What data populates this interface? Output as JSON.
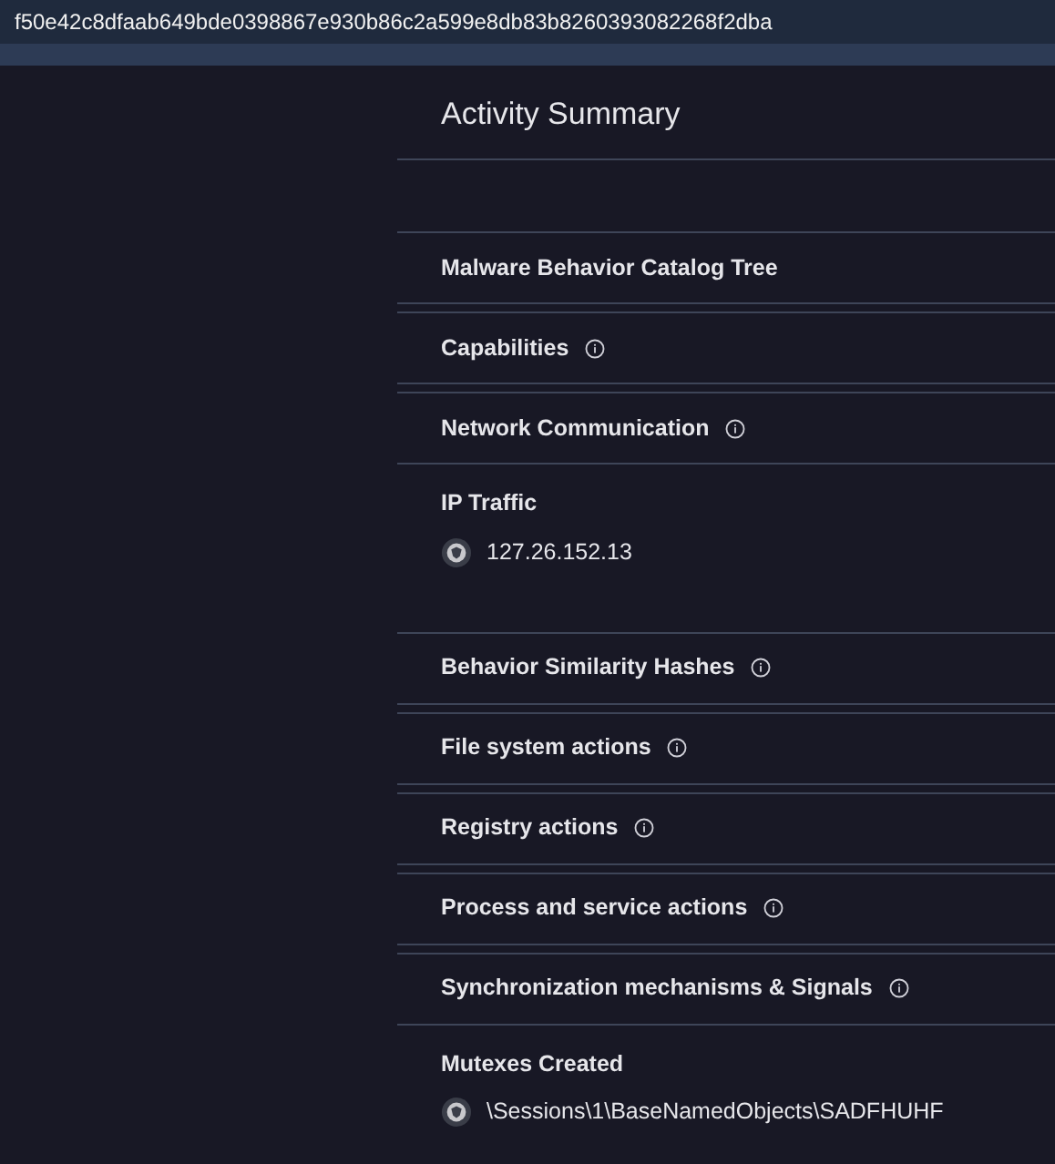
{
  "hash": "f50e42c8dfaab649bde0398867e930b86c2a599e8db83b8260393082268f2dba",
  "title": "Activity Summary",
  "sections": [
    {
      "title": "Malware Behavior Catalog Tree",
      "info": false
    },
    {
      "title": "Capabilities",
      "info": true
    },
    {
      "title": "Network Communication",
      "info": true,
      "detail": {
        "label": "IP Traffic",
        "entries": [
          "127.26.152.13"
        ]
      }
    },
    {
      "title": "Behavior Similarity Hashes",
      "info": true
    },
    {
      "title": "File system actions",
      "info": true
    },
    {
      "title": "Registry actions",
      "info": true
    },
    {
      "title": "Process and service actions",
      "info": true
    },
    {
      "title": "Synchronization mechanisms & Signals",
      "info": true,
      "detail": {
        "label": "Mutexes Created",
        "entries": [
          "\\Sessions\\1\\BaseNamedObjects\\SADFHUHF"
        ]
      }
    }
  ]
}
